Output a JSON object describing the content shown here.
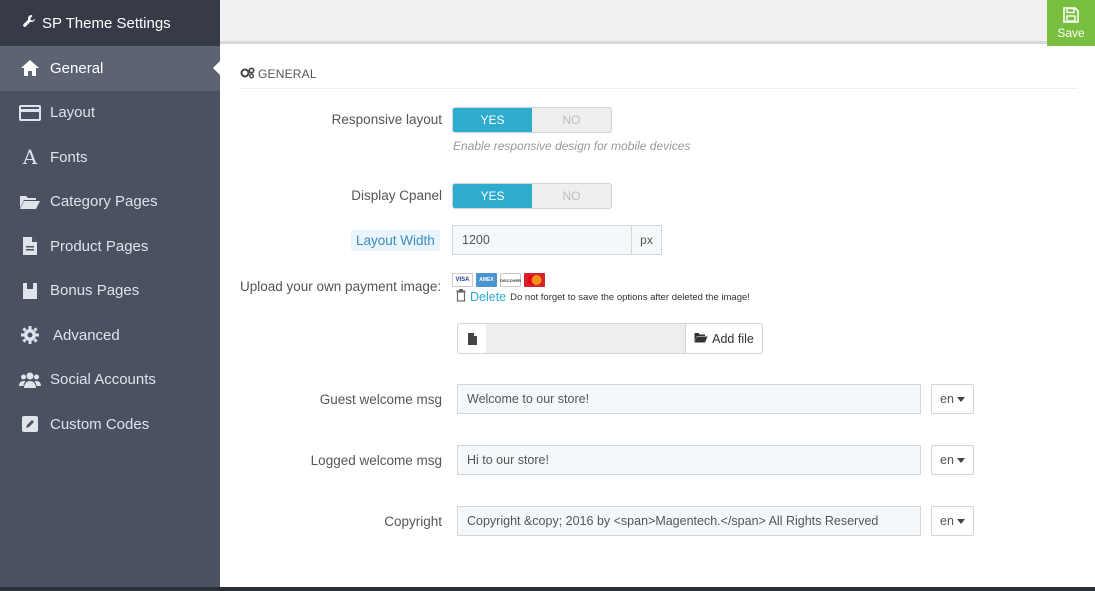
{
  "app": {
    "title": "SP Theme Settings"
  },
  "toolbar": {
    "save_label": "Save"
  },
  "sidebar": {
    "items": [
      {
        "label": "General",
        "icon": "home-icon",
        "active": true
      },
      {
        "label": "Layout",
        "icon": "layout-icon"
      },
      {
        "label": "Fonts",
        "icon": "font-icon"
      },
      {
        "label": "Category Pages",
        "icon": "folder-open-icon"
      },
      {
        "label": "Product Pages",
        "icon": "file-icon"
      },
      {
        "label": "Bonus Pages",
        "icon": "bookmark-icon"
      },
      {
        "label": "Advanced",
        "icon": "gear-icon"
      },
      {
        "label": "Social Accounts",
        "icon": "users-icon"
      },
      {
        "label": "Custom Codes",
        "icon": "edit-icon"
      }
    ]
  },
  "section": {
    "title": "GENERAL"
  },
  "form": {
    "responsive": {
      "label": "Responsive layout",
      "yes": "YES",
      "no": "NO",
      "help": "Enable responsive design for mobile devices"
    },
    "cpanel": {
      "label": "Display Cpanel",
      "yes": "YES",
      "no": "NO"
    },
    "layout_width": {
      "label": "Layout Width",
      "value": "1200",
      "unit": "px"
    },
    "payment": {
      "label": "Upload your own payment image:",
      "cards": [
        "VISA",
        "AMEX",
        "DISCOVER",
        "MC"
      ],
      "delete_label": "Delete",
      "delete_note": "Do not forget to save the options after deleted the image!",
      "add_file_label": "Add file"
    },
    "guest_welcome": {
      "label": "Guest welcome msg",
      "value": "Welcome to our store!",
      "lang": "en"
    },
    "logged_welcome": {
      "label": "Logged welcome msg",
      "value": "Hi to our store!",
      "lang": "en"
    },
    "copyright": {
      "label": "Copyright",
      "value": "Copyright &copy; 2016 by <span>Magentech.</span> All Rights Reserved",
      "lang": "en"
    }
  },
  "colors": {
    "accent": "#2eacce",
    "save": "#79bf3f",
    "sidebar": "#4a5160",
    "sidebar_header": "#363b47"
  }
}
